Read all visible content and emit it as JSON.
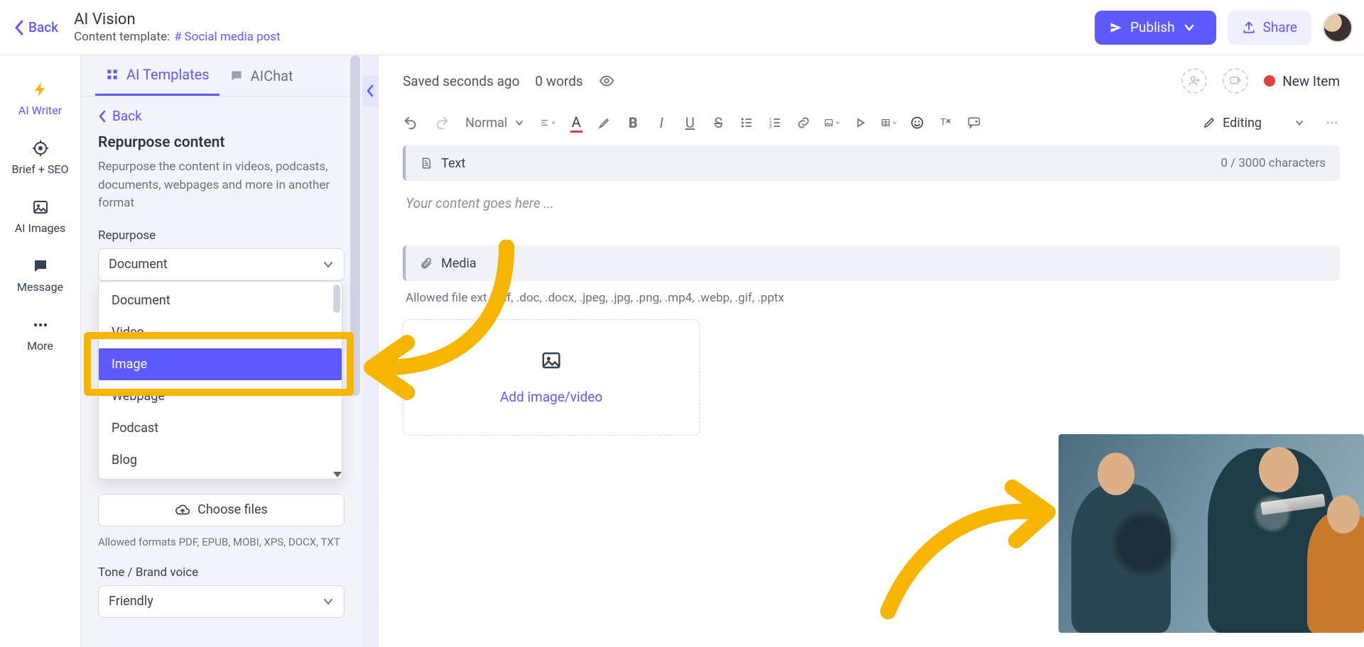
{
  "header": {
    "back": "Back",
    "title": "AI Vision",
    "subtitle_label": "Content template:",
    "template_hash": "#",
    "template_name": "Social media post",
    "publish": "Publish",
    "share": "Share"
  },
  "rail": {
    "writer": "AI Writer",
    "brief": "Brief + SEO",
    "images": "AI Images",
    "message": "Message",
    "more": "More"
  },
  "panel": {
    "tab_templates": "AI Templates",
    "tab_chat": "AIChat",
    "back": "Back",
    "heading": "Repurpose content",
    "desc": "Repurpose the content in videos, podcasts, documents, webpages and more in another format",
    "repurpose_label": "Repurpose",
    "repurpose_value": "Document",
    "choose_files": "Choose files",
    "formats_note": "Allowed formats PDF, EPUB, MOBI, XPS, DOCX, TXT",
    "tone_label": "Tone / Brand voice",
    "tone_value": "Friendly",
    "options": {
      "o0": "Document",
      "o1": "Video",
      "o2": "Image",
      "o3": "Webpage",
      "o4": "Podcast",
      "o5": "Blog"
    }
  },
  "editor": {
    "saved": "Saved seconds ago",
    "words": "0 words",
    "status": "New Item",
    "style_select": "Normal",
    "mode": "Editing",
    "text_block": "Text",
    "text_counter": "0 / 3000 characters",
    "text_placeholder": "Your content goes here ...",
    "media_block": "Media",
    "media_note": "Allowed file ext    .pdf, .doc, .docx, .jpeg, .jpg, .png, .mp4, .webp, .gif, .pptx",
    "upload_label": "Add image/video"
  }
}
